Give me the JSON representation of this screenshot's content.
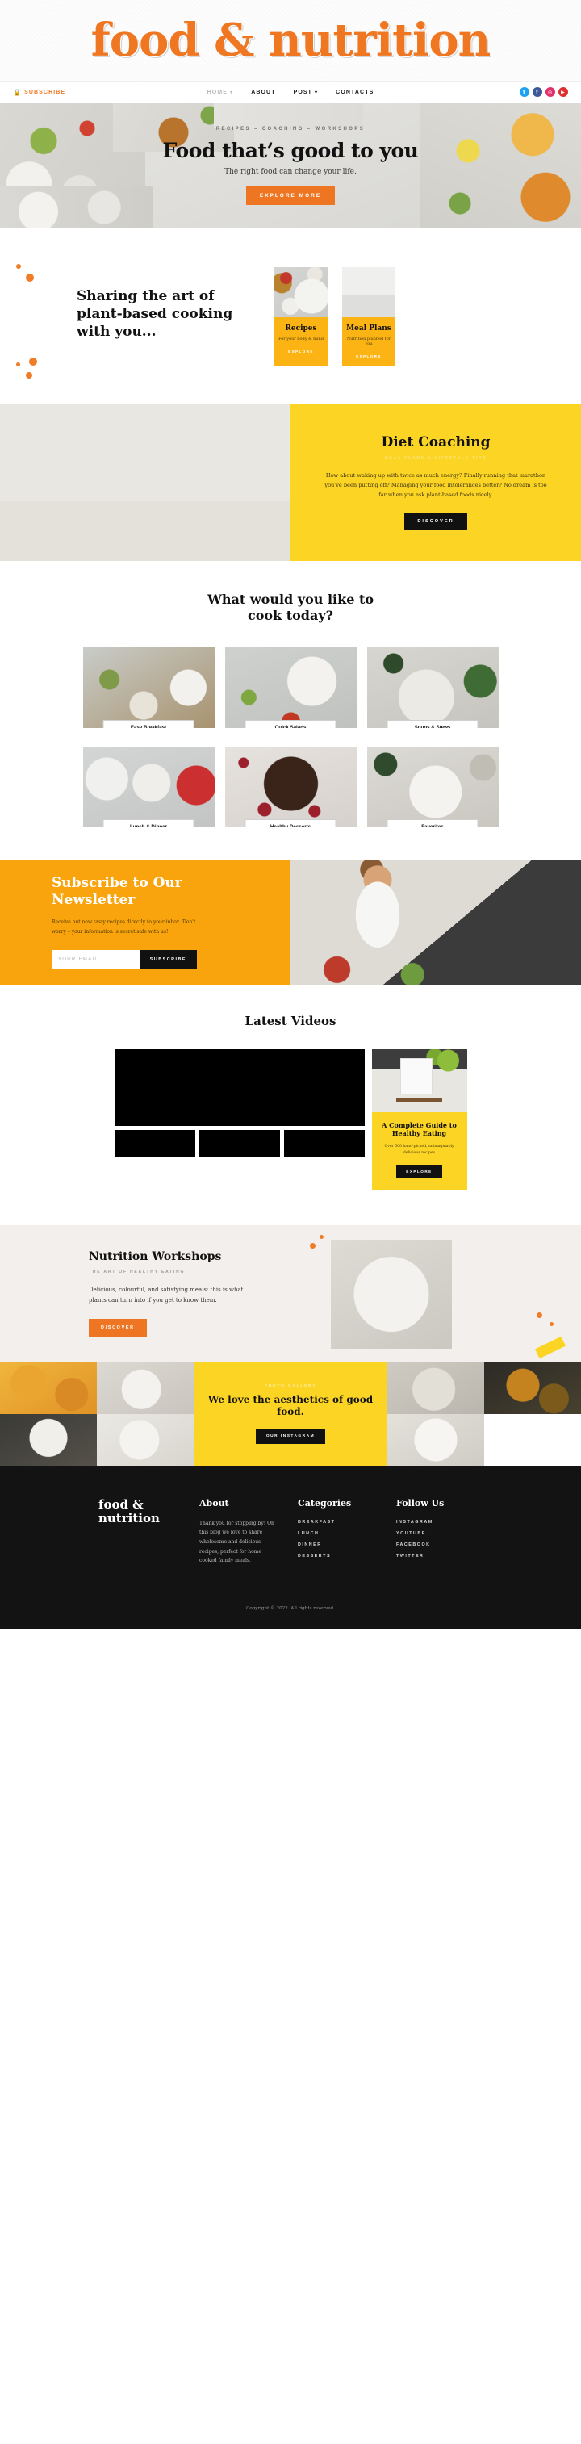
{
  "brand": {
    "logo": "food & nutrition",
    "logo_line1": "food &",
    "logo_line2": "nutrition",
    "accent": "#ef7722",
    "yellow": "#fcd424",
    "amber": "#f9a40c"
  },
  "nav": {
    "subscribe": "SUBSCRIBE",
    "lock_icon": "lock-icon",
    "items": [
      {
        "label": "HOME",
        "caret": "▾",
        "active": false
      },
      {
        "label": "ABOUT",
        "caret": ""
      },
      {
        "label": "POST",
        "caret": "▾"
      },
      {
        "label": "CONTACTS",
        "caret": ""
      }
    ],
    "social": [
      {
        "name": "twitter",
        "glyph": "t"
      },
      {
        "name": "facebook",
        "glyph": "f"
      },
      {
        "name": "instagram",
        "glyph": "◎"
      },
      {
        "name": "youtube",
        "glyph": "▶"
      }
    ]
  },
  "hero": {
    "kicker": "RECIPES – COACHING – WORKSHOPS",
    "title": "Food that’s good to you",
    "subtitle": "The right food can change your life.",
    "cta": "EXPLORE MORE"
  },
  "sharing": {
    "title": "Sharing the art of plant-based cooking with you...",
    "cards": [
      {
        "title": "Recipes",
        "desc": "For your body & mind",
        "link": "EXPLORE"
      },
      {
        "title": "Meal Plans",
        "desc": "Nutrition planned for you",
        "link": "EXPLORE"
      }
    ]
  },
  "coaching": {
    "title": "Diet Coaching",
    "kicker": "MEAL PLANS & LIFESTYLE TIPS",
    "body": "How about waking up with twice as much energy? Finally running that marathon you've been putting off? Managing your food intolerances better? No dream is too far when you ask plant-based foods nicely.",
    "cta": "DISCOVER"
  },
  "cook": {
    "heading": "What would you like to cook today?",
    "tiles": [
      {
        "label": "Easy Breakfast"
      },
      {
        "label": "Quick Salads"
      },
      {
        "label": "Soups & Stews"
      },
      {
        "label": "Lunch & Dinner"
      },
      {
        "label": "Healthy Desserts"
      },
      {
        "label": "Favorites"
      }
    ]
  },
  "newsletter": {
    "heading": "Subscribe to Our Newsletter",
    "body": "Receive out new tasty recipes directly to your inbox. Don't worry – your information is secret safe with us!",
    "email_placeholder": "YOUR EMAIL",
    "email_value": "",
    "cta": "SUBSCRIBE"
  },
  "videos": {
    "heading": "Latest Videos",
    "guide": {
      "title": "A Complete Guide to Healthy Eating",
      "body": "Over 500 hand-picked, unimaginably delicious recipes",
      "cta": "EXPLORE"
    }
  },
  "workshops": {
    "heading": "Nutrition Workshops",
    "kicker": "THE ART OF HEALTHY EATING",
    "body": "Delicious, colourful, and satisfying meals: this is what plants can turn into if you get to know them.",
    "cta": "DISCOVER"
  },
  "instagram": {
    "kicker": "PHOTO GALLERY",
    "heading": "We love the aesthetics of good food.",
    "cta": "OUR INSTAGRAM"
  },
  "footer": {
    "about_title": "About",
    "about_body": "Thank you for stopping by! On this blog we love to share wholesome and delicious recipes, perfect for home cooked family meals.",
    "categories_title": "Categories",
    "categories": [
      "BREAKFAST",
      "LUNCH",
      "DINNER",
      "DESSERTS"
    ],
    "follow_title": "Follow Us",
    "follow": [
      "INSTAGRAM",
      "YOUTUBE",
      "FACEBOOK",
      "TWITTER"
    ],
    "copyright": "Copyright © 2022. All rights reserved."
  }
}
